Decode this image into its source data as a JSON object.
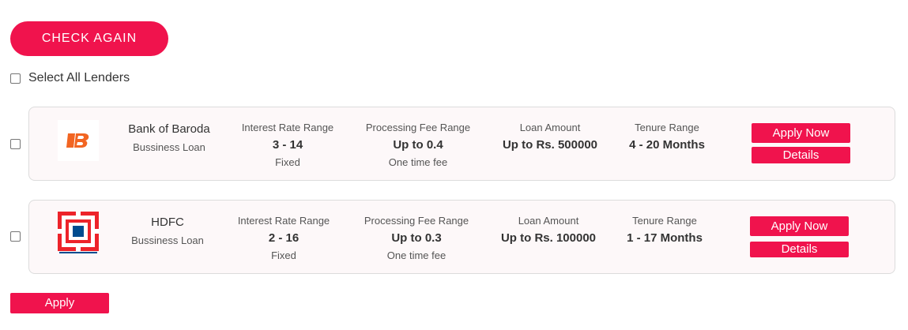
{
  "header": {
    "check_again_label": "CHECK AGAIN"
  },
  "select_all": {
    "label": "Select All Lenders",
    "checked": false
  },
  "lenders": [
    {
      "name": "Bank of Baroda",
      "loan_type": "Bussiness Loan",
      "logo_icon": "bank-of-baroda-logo",
      "interest_label": "Interest Rate Range",
      "interest_value": "3 - 14",
      "interest_type": "Fixed",
      "fee_label": "Processing Fee Range",
      "fee_value": "Up to 0.4",
      "fee_type": "One time fee",
      "amount_label": "Loan Amount",
      "amount_value": "Up to Rs. 500000",
      "tenure_label": "Tenure Range",
      "tenure_value": "4 - 20 Months",
      "apply_now_label": "Apply Now",
      "details_label": "Details",
      "checked": false
    },
    {
      "name": "HDFC",
      "loan_type": "Bussiness Loan",
      "logo_icon": "hdfc-bank-logo",
      "interest_label": "Interest Rate Range",
      "interest_value": "2 - 16",
      "interest_type": "Fixed",
      "fee_label": "Processing Fee Range",
      "fee_value": "Up to 0.3",
      "fee_type": "One time fee",
      "amount_label": "Loan Amount",
      "amount_value": "Up to Rs. 100000",
      "tenure_label": "Tenure Range",
      "tenure_value": "1 - 17 Months",
      "apply_now_label": "Apply Now",
      "details_label": "Details",
      "checked": false
    }
  ],
  "footer": {
    "apply_label": "Apply"
  },
  "colors": {
    "accent": "#f0134d",
    "card_bg": "#fdf8f9",
    "bob_orange": "#f26522",
    "hdfc_red": "#ed232a",
    "hdfc_blue": "#004c8f"
  }
}
